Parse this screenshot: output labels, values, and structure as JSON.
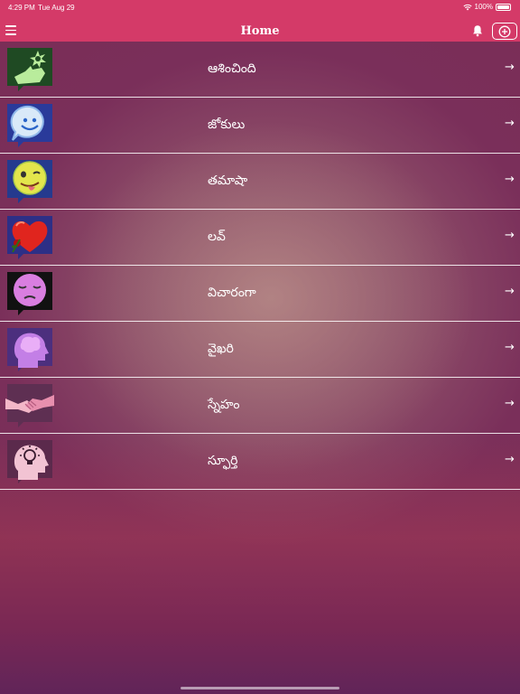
{
  "status_bar": {
    "time": "4:29 PM",
    "date": "Tue Aug 29",
    "battery": "100%",
    "battery_level": 1.0,
    "wifi_icon": "wifi-icon",
    "battery_icon": "battery-icon"
  },
  "nav": {
    "title": "Home",
    "menu_icon": "hamburger-menu-icon",
    "notification_icon": "bell-icon",
    "add_icon": "plus-circle-icon"
  },
  "categories": [
    {
      "label": "ఆశించింది",
      "icon": "hand-flower-icon"
    },
    {
      "label": "జోకులు",
      "icon": "smiley-bubble-icon"
    },
    {
      "label": "తమాషా",
      "icon": "tongue-face-icon"
    },
    {
      "label": "లవ్",
      "icon": "heart-rose-icon"
    },
    {
      "label": "విచారంగా",
      "icon": "sad-face-icon"
    },
    {
      "label": "వైఖరి",
      "icon": "head-brain-icon"
    },
    {
      "label": "స్నేహం",
      "icon": "handshake-icon"
    },
    {
      "label": "స్ఫూర్తి",
      "icon": "lightbulb-head-icon"
    }
  ],
  "row_arrow": "→",
  "colors": {
    "nav_bar": "#d43a68",
    "background_top": "#7a2e57",
    "background_center": "#a86a6c"
  }
}
